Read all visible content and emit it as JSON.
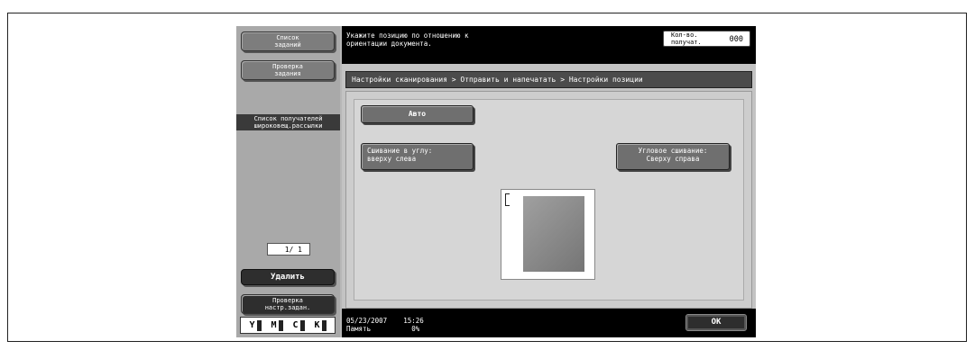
{
  "sidebar": {
    "job_list_label": "Список\nзаданий",
    "job_check_label": "Проверка\nзадания",
    "broadcast_label": "Список получателей\nшироковещ.рассылки",
    "page_indicator": "1/  1",
    "delete_label": "Удалить",
    "check_settings_label": "Проверка\nнастр.задан.",
    "toner": [
      "Y",
      "M",
      "C",
      "K"
    ]
  },
  "header": {
    "message": "Укажите позицию по отношению к\nориентации документа.",
    "count_label": "Кол-во.\nполучат.",
    "count_value": "000"
  },
  "breadcrumb": "Настройки сканирования > Отправить и напечатать > Настройки позиции",
  "options": {
    "auto": "Авто",
    "corner_left": "Сшивание в углу:\nвверху слева",
    "corner_right": "Угловое сшивание:\nСверху справа"
  },
  "status": {
    "datetime": "05/23/2007    15:26",
    "memory": "Память          0%"
  },
  "ok_label": "OK"
}
